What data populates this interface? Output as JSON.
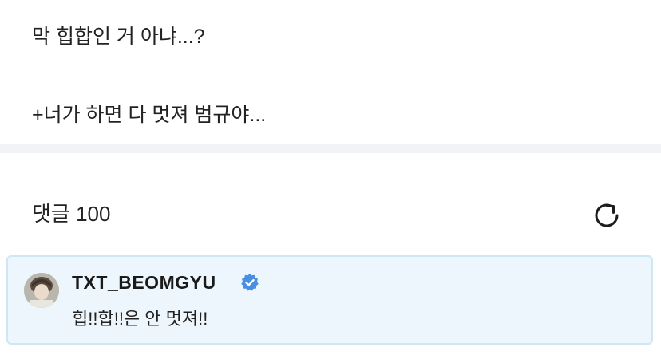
{
  "post": {
    "line1": "막 힙합인 거 아냐...?",
    "line2": "+너가 하면 다 멋져 범규야..."
  },
  "comments": {
    "header": "댓글 100",
    "refresh_icon": "refresh-icon"
  },
  "highlighted_comment": {
    "username": "TXT_BEOMGYU",
    "verified": true,
    "verified_color": "#4a90e2",
    "text": "힙!!합!!은 안 멋져!!"
  }
}
